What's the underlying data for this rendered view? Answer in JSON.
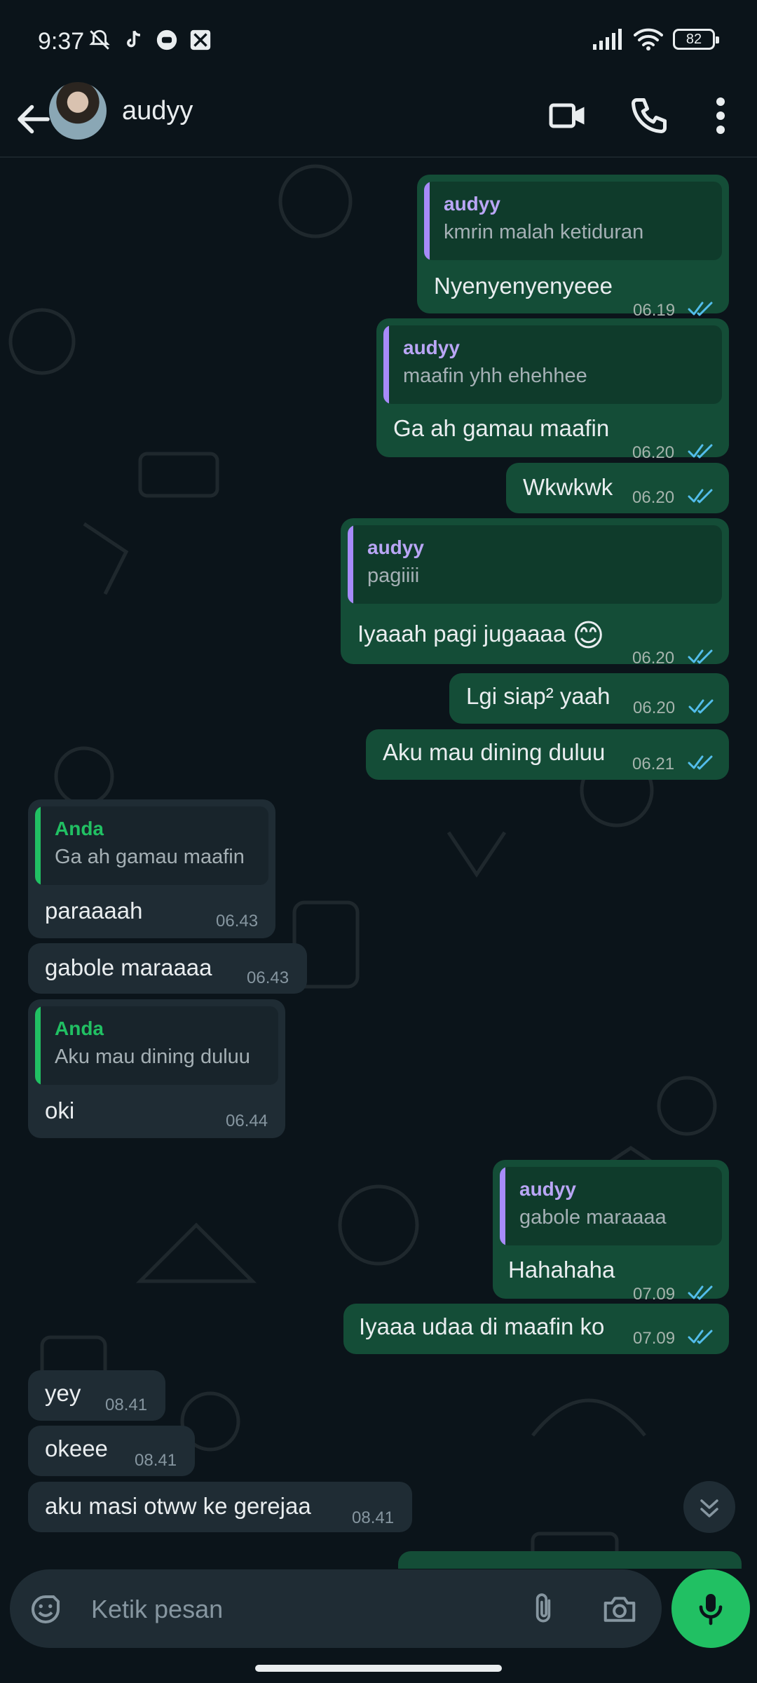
{
  "status_bar": {
    "time": "9:37",
    "battery": "82"
  },
  "header": {
    "contact_name": "audyy"
  },
  "messages": [
    {
      "reply_name": "audyy",
      "reply_text": "kmrin malah ketiduran",
      "text": "Nyenyenyenyeee",
      "time": "06.19"
    },
    {
      "reply_name": "audyy",
      "reply_text": "maafin yhh ehehhee",
      "text": "Ga ah gamau maafin",
      "time": "06.20"
    },
    {
      "text": "Wkwkwk",
      "time": "06.20"
    },
    {
      "reply_name": "audyy",
      "reply_text": "pagiiii",
      "text": "Iyaaah pagi jugaaaa",
      "emoji": "😊",
      "time": "06.20"
    },
    {
      "text": "Lgi siap² yaah",
      "time": "06.20"
    },
    {
      "text": "Aku mau dining duluu",
      "time": "06.21"
    },
    {
      "reply_name": "Anda",
      "reply_text": "Ga ah gamau maafin",
      "text": "paraaaah",
      "time": "06.43"
    },
    {
      "text": "gabole maraaaa",
      "time": "06.43"
    },
    {
      "reply_name": "Anda",
      "reply_text": "Aku mau dining duluu",
      "text": "oki",
      "time": "06.44"
    },
    {
      "reply_name": "audyy",
      "reply_text": "gabole maraaaa",
      "text": "Hahahaha",
      "time": "07.09"
    },
    {
      "text": "Iyaaa udaa di maafin ko",
      "time": "07.09"
    },
    {
      "text": "yey",
      "time": "08.41"
    },
    {
      "text": "okeee",
      "time": "08.41"
    },
    {
      "text": "aku masi otww ke gerejaa",
      "time": "08.41"
    }
  ],
  "composer": {
    "placeholder": "Ketik pesan"
  },
  "colors": {
    "outgoing_bubble": "#144d37",
    "incoming_bubble": "#1f2c34",
    "read_ticks": "#53bdeb",
    "accent": "#21c063",
    "background": "#0b141a"
  },
  "icons": [
    "back-arrow-icon",
    "video-call-icon",
    "voice-call-icon",
    "more-options-icon",
    "sticker-icon",
    "attach-icon",
    "camera-icon",
    "mic-icon",
    "scroll-down-icon"
  ]
}
